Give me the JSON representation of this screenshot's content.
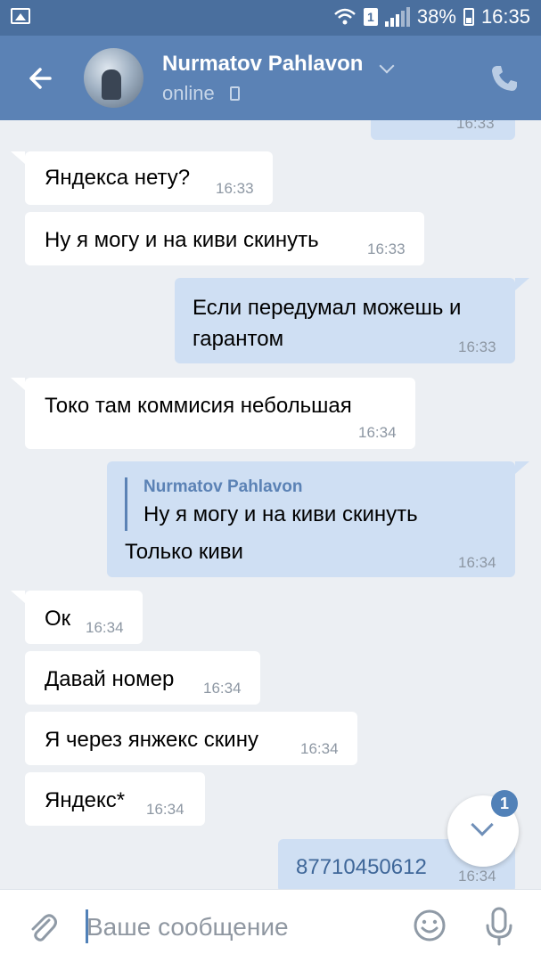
{
  "status_bar": {
    "sim_badge": "1",
    "battery": "38%",
    "time": "16:35"
  },
  "header": {
    "contact_name": "Nurmatov Pahlavon",
    "status": "online"
  },
  "messages": [
    {
      "text": "16:33"
    },
    {
      "text": "Яндекса нету?",
      "time": "16:33"
    },
    {
      "text": "Ну я могу и на киви скинуть",
      "time": "16:33"
    },
    {
      "line1": "Если передумал можешь и",
      "line2": "гарантом",
      "time": "16:33"
    },
    {
      "text": "Токо там коммисия небольшая",
      "time": "16:34"
    },
    {
      "quote_author": "Nurmatov Pahlavon",
      "quote_text": "Ну я могу и на киви скинуть",
      "text": "Только киви",
      "time": "16:34"
    },
    {
      "text": "Ок",
      "time": "16:34"
    },
    {
      "text": "Давай номер",
      "time": "16:34"
    },
    {
      "text": "Я через янжекс скину",
      "time": "16:34"
    },
    {
      "text": "Яндекс*",
      "time": "16:34"
    },
    {
      "text": "87710450612",
      "time": "16:34"
    }
  ],
  "scroll_button": {
    "unread_count": "1"
  },
  "composer": {
    "placeholder": "Ваше сообщение"
  },
  "colors": {
    "header": "#5b82b5",
    "status_bar": "#4a6f9e",
    "outgoing_bubble": "#cfdff3",
    "incoming_bubble": "#ffffff",
    "background": "#eceff3"
  },
  "icons": [
    "image-icon",
    "wifi-icon",
    "signal-icon",
    "battery-icon",
    "back-arrow-icon",
    "chevron-down-icon",
    "mobile-phone-icon",
    "phone-call-icon",
    "paperclip-icon",
    "emoji-icon",
    "microphone-icon"
  ]
}
